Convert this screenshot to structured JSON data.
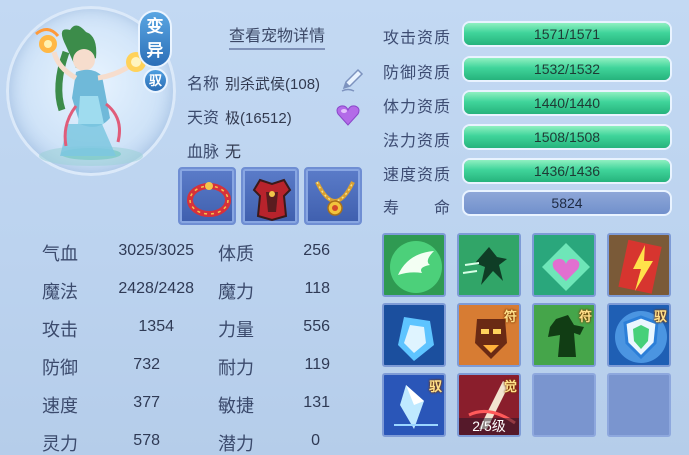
{
  "pet": {
    "detail_link": "查看宠物详情",
    "badges": {
      "transform": "变异",
      "ride": "驭"
    },
    "name_label": "名称",
    "name_value": "别杀武侯(108)",
    "talent_label": "天资",
    "talent_value": "极(16512)",
    "bloodline_label": "血脉",
    "bloodline_value": "无"
  },
  "equipment": [
    {
      "icon": "red-bracelet-icon"
    },
    {
      "icon": "red-armor-icon"
    },
    {
      "icon": "gold-necklace-icon"
    }
  ],
  "attributes": [
    {
      "label": "气血",
      "value": "3025/3025",
      "label2": "体质",
      "value2": "256"
    },
    {
      "label": "魔法",
      "value": "2428/2428",
      "label2": "魔力",
      "value2": "118"
    },
    {
      "label": "攻击",
      "value": "1354",
      "label2": "力量",
      "value2": "556"
    },
    {
      "label": "防御",
      "value": "732",
      "label2": "耐力",
      "value2": "119"
    },
    {
      "label": "速度",
      "value": "377",
      "label2": "敏捷",
      "value2": "131"
    },
    {
      "label": "灵力",
      "value": "578",
      "label2": "潜力",
      "value2": "0"
    }
  ],
  "aptitudes": [
    {
      "label": "攻击资质",
      "text": "1571/1571",
      "fill": 1.0
    },
    {
      "label": "防御资质",
      "text": "1532/1532",
      "fill": 1.0
    },
    {
      "label": "体力资质",
      "text": "1440/1440",
      "fill": 1.0
    },
    {
      "label": "法力资质",
      "text": "1508/1508",
      "fill": 1.0
    },
    {
      "label": "速度资质",
      "text": "1436/1436",
      "fill": 1.0
    }
  ],
  "life": {
    "label": "寿　　命",
    "value": "5824"
  },
  "skills": [
    {
      "icon": "wing-skill-icon",
      "tag": ""
    },
    {
      "icon": "dash-skill-icon",
      "tag": ""
    },
    {
      "icon": "heart-skill-icon",
      "tag": ""
    },
    {
      "icon": "lightning-card-skill-icon",
      "tag": ""
    },
    {
      "icon": "ice-shield-skill-icon",
      "tag": ""
    },
    {
      "icon": "mask-skill-icon",
      "tag": "符"
    },
    {
      "icon": "power-skill-icon",
      "tag": "符"
    },
    {
      "icon": "blue-shield-skill-icon",
      "tag": "驭"
    },
    {
      "icon": "crystal-skill-icon",
      "tag": "驭"
    },
    {
      "icon": "awaken-skill-icon",
      "tag": "觉",
      "level": "2/5级"
    },
    {
      "icon": "empty-slot",
      "tag": ""
    },
    {
      "icon": "empty-slot",
      "tag": ""
    }
  ]
}
